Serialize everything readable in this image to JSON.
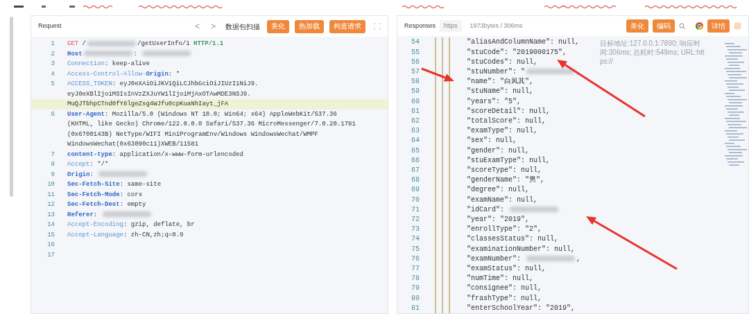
{
  "request": {
    "title": "Request",
    "nav": [
      "<",
      ">"
    ],
    "scan_label": "数据包扫描",
    "buttons": [
      "美化",
      "热加载",
      "构造请求"
    ],
    "lines": [
      {
        "no": "1",
        "highlighted": false,
        "parts": [
          {
            "kind": "method",
            "text": "GET"
          },
          {
            "kind": "plain",
            "text": " /"
          },
          {
            "kind": "blur"
          },
          {
            "kind": "plain",
            "text": "/getUserInfo/1 "
          },
          {
            "kind": "version",
            "text": "HTTP/1.1"
          }
        ]
      },
      {
        "no": "2",
        "highlighted": false,
        "parts": [
          {
            "kind": "header",
            "text": "Host"
          },
          {
            "kind": "blur"
          },
          {
            "kind": "plain",
            "text": ": "
          },
          {
            "kind": "blur"
          }
        ]
      },
      {
        "no": "3",
        "highlighted": false,
        "parts": [
          {
            "kind": "header-light",
            "text": "Connection"
          },
          {
            "kind": "plain",
            "text": ": keep-alive"
          }
        ]
      },
      {
        "no": "4",
        "highlighted": false,
        "parts": [
          {
            "kind": "header-light",
            "text": "Access-Control-Allow-"
          },
          {
            "kind": "header",
            "text": "Origin"
          },
          {
            "kind": "plain",
            "text": ": *"
          }
        ]
      },
      {
        "no": "5",
        "highlighted": false,
        "parts": [
          {
            "kind": "header-light",
            "text": "ACCESS_TOKEN"
          },
          {
            "kind": "plain",
            "text": ": eyJ0eXAiOiJKV1QiLCJhbGciOiJIUzI1NiJ9."
          }
        ],
        "continuations": [
          {
            "highlighted": false,
            "parts": [
              {
                "kind": "plain",
                "text": "eyJ0eXBlIjoiMSIsInVzZXJuYW1lIjoiMjAxOTAwMDE3NSJ9."
              }
            ]
          },
          {
            "highlighted": true,
            "parts": [
              {
                "kind": "plain",
                "text": "MuQJTbhpCTnd0fY8lgeZsg4WJfu0cpKuaNhIayt_jFA"
              }
            ]
          }
        ]
      },
      {
        "no": "6",
        "highlighted": false,
        "parts": [
          {
            "kind": "header",
            "text": "User-Agent"
          },
          {
            "kind": "plain",
            "text": ": Mozilla/5.0 (Windows NT 10.0; Win64; x64) AppleWebKit/537.36"
          }
        ],
        "continuations": [
          {
            "highlighted": false,
            "parts": [
              {
                "kind": "plain",
                "text": "(KHTML, like Gecko) Chrome/122.0.0.0 Safari/537.36 MicroMessenger/7.0.20.1781"
              }
            ]
          },
          {
            "highlighted": false,
            "parts": [
              {
                "kind": "plain",
                "text": "(0x6700143B) NetType/WIFI MiniProgramEnv/Windows WindowsWechat/WMPF"
              }
            ]
          },
          {
            "highlighted": false,
            "parts": [
              {
                "kind": "plain",
                "text": "WindowsWechat(0x63090c11)XWEB/11581"
              }
            ]
          }
        ]
      },
      {
        "no": "7",
        "highlighted": false,
        "parts": [
          {
            "kind": "header",
            "text": "content-type"
          },
          {
            "kind": "plain",
            "text": ": application/x-www-form-urlencoded"
          }
        ]
      },
      {
        "no": "8",
        "highlighted": false,
        "parts": [
          {
            "kind": "header-light",
            "text": "Accept"
          },
          {
            "kind": "plain",
            "text": ": */*"
          }
        ]
      },
      {
        "no": "9",
        "highlighted": false,
        "parts": [
          {
            "kind": "header",
            "text": "Origin"
          },
          {
            "kind": "plain",
            "text": ": "
          },
          {
            "kind": "blur"
          }
        ]
      },
      {
        "no": "10",
        "highlighted": false,
        "parts": [
          {
            "kind": "header",
            "text": "Sec-Fetch-Site"
          },
          {
            "kind": "plain",
            "text": ": same-site"
          }
        ]
      },
      {
        "no": "11",
        "highlighted": false,
        "parts": [
          {
            "kind": "header",
            "text": "Sec-Fetch-Mode"
          },
          {
            "kind": "plain",
            "text": ": cors"
          }
        ]
      },
      {
        "no": "12",
        "highlighted": false,
        "parts": [
          {
            "kind": "header",
            "text": "Sec-Fetch-Dest"
          },
          {
            "kind": "plain",
            "text": ": empty"
          }
        ]
      },
      {
        "no": "13",
        "highlighted": false,
        "parts": [
          {
            "kind": "header",
            "text": "Referer"
          },
          {
            "kind": "plain",
            "text": ": "
          },
          {
            "kind": "blur"
          }
        ]
      },
      {
        "no": "14",
        "highlighted": false,
        "parts": [
          {
            "kind": "header-light",
            "text": "Accept-Encoding"
          },
          {
            "kind": "plain",
            "text": ": gzip, deflate, br"
          }
        ]
      },
      {
        "no": "15",
        "highlighted": false,
        "parts": [
          {
            "kind": "header-light",
            "text": "Accept-Language"
          },
          {
            "kind": "plain",
            "text": ": zh-CN,zh;q=0.9"
          }
        ]
      },
      {
        "no": "16",
        "highlighted": false
      },
      {
        "no": "17",
        "highlighted": false
      }
    ]
  },
  "response": {
    "title": "Responses",
    "protocol": "https",
    "stats": "1973bytes / 306ms",
    "buttons": [
      "美化",
      "编码"
    ],
    "detail_button": "详情",
    "info": [
      "目标地址:127.0.0.1:7890; 响应时",
      "间:306ms; 总耗时:549ms; URL:htt",
      "ps://"
    ],
    "lines": [
      {
        "no": "54",
        "parts": [
          {
            "kind": "key",
            "text": "\"aliasAndColumnName\""
          },
          {
            "kind": "plain",
            "text": ": null,"
          }
        ]
      },
      {
        "no": "55",
        "parts": [
          {
            "kind": "key",
            "text": "\"stuCode\""
          },
          {
            "kind": "plain",
            "text": ": \"2019000175\","
          }
        ]
      },
      {
        "no": "56",
        "parts": [
          {
            "kind": "key",
            "text": "\"stuCodes\""
          },
          {
            "kind": "plain",
            "text": ": null,"
          }
        ]
      },
      {
        "no": "57",
        "parts": [
          {
            "kind": "key",
            "text": "\"stuNumber\""
          },
          {
            "kind": "plain",
            "text": ": \""
          },
          {
            "kind": "blur"
          },
          {
            "kind": "plain",
            "text": ","
          }
        ]
      },
      {
        "no": "58",
        "parts": [
          {
            "kind": "key",
            "text": "\"name\""
          },
          {
            "kind": "plain",
            "text": ": \"白凤其\","
          }
        ]
      },
      {
        "no": "59",
        "parts": [
          {
            "kind": "key",
            "text": "\"stuName\""
          },
          {
            "kind": "plain",
            "text": ": null,"
          }
        ]
      },
      {
        "no": "60",
        "parts": [
          {
            "kind": "key",
            "text": "\"years\""
          },
          {
            "kind": "plain",
            "text": ": \"5\","
          }
        ]
      },
      {
        "no": "61",
        "parts": [
          {
            "kind": "key",
            "text": "\"scoreDetail\""
          },
          {
            "kind": "plain",
            "text": ": null,"
          }
        ]
      },
      {
        "no": "62",
        "parts": [
          {
            "kind": "key",
            "text": "\"totalScore\""
          },
          {
            "kind": "plain",
            "text": ": null,"
          }
        ]
      },
      {
        "no": "63",
        "parts": [
          {
            "kind": "key",
            "text": "\"examType\""
          },
          {
            "kind": "plain",
            "text": ": null,"
          }
        ]
      },
      {
        "no": "64",
        "parts": [
          {
            "kind": "key",
            "text": "\"sex\""
          },
          {
            "kind": "plain",
            "text": ": null,"
          }
        ]
      },
      {
        "no": "65",
        "parts": [
          {
            "kind": "key",
            "text": "\"gender\""
          },
          {
            "kind": "plain",
            "text": ": null,"
          }
        ]
      },
      {
        "no": "66",
        "parts": [
          {
            "kind": "key",
            "text": "\"stuExamType\""
          },
          {
            "kind": "plain",
            "text": ": null,"
          }
        ]
      },
      {
        "no": "67",
        "parts": [
          {
            "kind": "key",
            "text": "\"scoreType\""
          },
          {
            "kind": "plain",
            "text": ": null,"
          }
        ]
      },
      {
        "no": "68",
        "parts": [
          {
            "kind": "key",
            "text": "\"genderName\""
          },
          {
            "kind": "plain",
            "text": ": \"男\","
          }
        ]
      },
      {
        "no": "69",
        "parts": [
          {
            "kind": "key",
            "text": "\"degree\""
          },
          {
            "kind": "plain",
            "text": ": null,"
          }
        ]
      },
      {
        "no": "70",
        "parts": [
          {
            "kind": "key",
            "text": "\"examName\""
          },
          {
            "kind": "plain",
            "text": ": null,"
          }
        ]
      },
      {
        "no": "71",
        "parts": [
          {
            "kind": "key",
            "text": "\"idCard\""
          },
          {
            "kind": "plain",
            "text": ": "
          },
          {
            "kind": "blur"
          }
        ]
      },
      {
        "no": "72",
        "parts": [
          {
            "kind": "key",
            "text": "\"year\""
          },
          {
            "kind": "plain",
            "text": ": \"2019\","
          }
        ]
      },
      {
        "no": "73",
        "parts": [
          {
            "kind": "key",
            "text": "\"enrollType\""
          },
          {
            "kind": "plain",
            "text": ": \"2\","
          }
        ]
      },
      {
        "no": "74",
        "parts": [
          {
            "kind": "key",
            "text": "\"classesStatus\""
          },
          {
            "kind": "plain",
            "text": ": null,"
          }
        ]
      },
      {
        "no": "75",
        "parts": [
          {
            "kind": "key",
            "text": "\"examinationNumber\""
          },
          {
            "kind": "plain",
            "text": ": null,"
          }
        ]
      },
      {
        "no": "76",
        "parts": [
          {
            "kind": "key",
            "text": "\"examNumber\""
          },
          {
            "kind": "plain",
            "text": ": "
          },
          {
            "kind": "blur"
          },
          {
            "kind": "plain",
            "text": ","
          }
        ]
      },
      {
        "no": "77",
        "parts": [
          {
            "kind": "key",
            "text": "\"examStatus\""
          },
          {
            "kind": "plain",
            "text": ": null,"
          }
        ]
      },
      {
        "no": "78",
        "parts": [
          {
            "kind": "key",
            "text": "\"numTime\""
          },
          {
            "kind": "plain",
            "text": ": null,"
          }
        ]
      },
      {
        "no": "79",
        "parts": [
          {
            "kind": "key",
            "text": "\"consignee\""
          },
          {
            "kind": "plain",
            "text": ": null,"
          }
        ]
      },
      {
        "no": "80",
        "parts": [
          {
            "kind": "key",
            "text": "\"frashType\""
          },
          {
            "kind": "plain",
            "text": ": null,"
          }
        ]
      },
      {
        "no": "81",
        "parts": [
          {
            "kind": "key",
            "text": "\"enterSchoolYear\""
          },
          {
            "kind": "plain",
            "text": ": \"2019\","
          }
        ]
      }
    ]
  }
}
